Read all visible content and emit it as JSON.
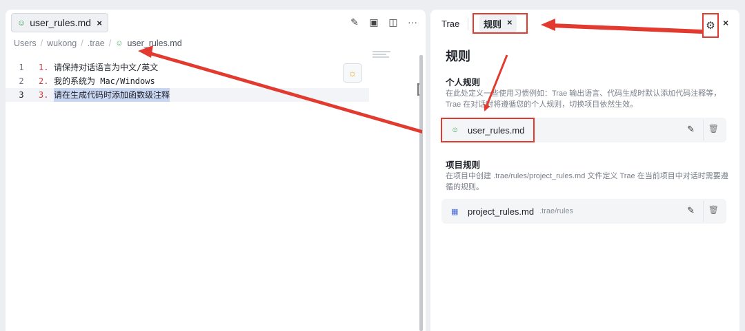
{
  "editor": {
    "tab_title": "user_rules.md",
    "tab_close": "×",
    "breadcrumb": [
      "Users",
      "wukong",
      ".trae",
      "user_rules.md"
    ],
    "tool_icons": [
      "edit-icon",
      "preview-icon",
      "split-icon",
      "more-icon"
    ],
    "more_glyph": "···",
    "lines": [
      {
        "ln": "1",
        "num": "1.",
        "text": "请保持对话语言为中文/英文"
      },
      {
        "ln": "2",
        "num": "2.",
        "text": "我的系统为 Mac/Windows"
      },
      {
        "ln": "3",
        "num": "3.",
        "text": "请在生成代码时添加函数级注释"
      }
    ]
  },
  "panel": {
    "tab_trae": "Trae",
    "tab_rules": "规则",
    "tab_rules_close": "×",
    "close": "×",
    "title": "规则",
    "personal": {
      "title": "个人规则",
      "desc": "在此处定义一些使用习惯例如：Trae 输出语言、代码生成时默认添加代码注释等，Trae 在对话时将遵循您的个人规则，切换项目依然生效。",
      "file": "user_rules.md"
    },
    "project": {
      "title": "项目规则",
      "desc": "在项目中创建 .trae/rules/project_rules.md 文件定义 Trae 在当前项目中对话时需要遵循的规则。",
      "file": "project_rules.md",
      "path": ".trae/rules"
    }
  },
  "colors": {
    "annotation": "#e23a2e",
    "accent_green": "#3aa055"
  }
}
